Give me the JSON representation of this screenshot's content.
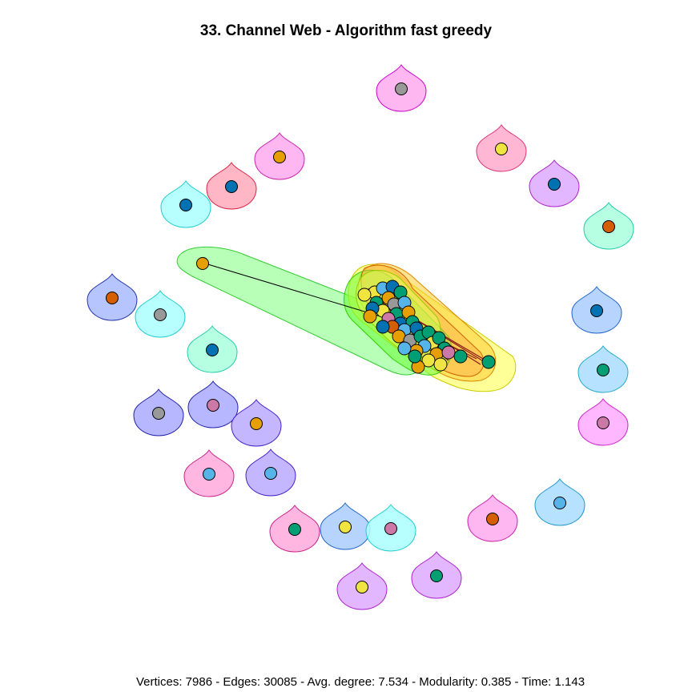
{
  "title": "33. Channel Web - Algorithm fast greedy",
  "caption": "Vertices: 7986 - Edges: 30085 - Avg. degree: 7.534 - Modularity: 0.385 - Time: 1.143",
  "palette": {
    "node_yellow": "#f0e442",
    "node_orange": "#e69f00",
    "node_vermillion": "#d55e00",
    "node_skyblue": "#56b4e9",
    "node_blue": "#0072b2",
    "node_green": "#009e73",
    "node_pink": "#cc79a7",
    "node_gray": "#999999",
    "hull_green": "#66ff66",
    "hull_yellow": "#ffff00",
    "hull_orange": "#ff9900"
  },
  "singleton_communities": [
    {
      "id": 1,
      "node_color": "#999999",
      "hull_fill": "#ffaaee",
      "hull_stroke": "#cc00cc"
    },
    {
      "id": 2,
      "node_color": "#f0e442",
      "hull_fill": "#ffaacc",
      "hull_stroke": "#dd3377"
    },
    {
      "id": 3,
      "node_color": "#0072b2",
      "hull_fill": "#ddaaff",
      "hull_stroke": "#aa22cc"
    },
    {
      "id": 4,
      "node_color": "#d55e00",
      "hull_fill": "#aaffdd",
      "hull_stroke": "#22ccaa"
    },
    {
      "id": 5,
      "node_color": "#e69f00",
      "hull_fill": "#ffaaee",
      "hull_stroke": "#cc22aa"
    },
    {
      "id": 6,
      "node_color": "#0072b2",
      "hull_fill": "#ffaabb",
      "hull_stroke": "#dd2244"
    },
    {
      "id": 7,
      "node_color": "#0072b2",
      "hull_fill": "#aaffff",
      "hull_stroke": "#22cccc"
    },
    {
      "id": 8,
      "node_color": "#d55e00",
      "hull_fill": "#aabbff",
      "hull_stroke": "#2233aa"
    },
    {
      "id": 9,
      "node_color": "#999999",
      "hull_fill": "#aaffff",
      "hull_stroke": "#22cccc"
    },
    {
      "id": 10,
      "node_color": "#0072b2",
      "hull_fill": "#aaffdd",
      "hull_stroke": "#22ccaa"
    },
    {
      "id": 11,
      "node_color": "#0072b2",
      "hull_fill": "#aaccff",
      "hull_stroke": "#2266cc"
    },
    {
      "id": 12,
      "node_color": "#009e73",
      "hull_fill": "#aaddff",
      "hull_stroke": "#22aacc"
    },
    {
      "id": 13,
      "node_color": "#cc79a7",
      "hull_fill": "#ffaaff",
      "hull_stroke": "#cc22cc"
    },
    {
      "id": 14,
      "node_color": "#999999",
      "hull_fill": "#aaaaff",
      "hull_stroke": "#2222aa"
    },
    {
      "id": 15,
      "node_color": "#cc79a7",
      "hull_fill": "#aaaaff",
      "hull_stroke": "#2222aa"
    },
    {
      "id": 16,
      "node_color": "#e69f00",
      "hull_fill": "#bbaaff",
      "hull_stroke": "#4422cc"
    },
    {
      "id": 17,
      "node_color": "#56b4e9",
      "hull_fill": "#bbaaff",
      "hull_stroke": "#4422cc"
    },
    {
      "id": 18,
      "node_color": "#56b4e9",
      "hull_fill": "#ffaadd",
      "hull_stroke": "#cc2288"
    },
    {
      "id": 19,
      "node_color": "#56b4e9",
      "hull_fill": "#aaddff",
      "hull_stroke": "#2299cc"
    },
    {
      "id": 20,
      "node_color": "#d55e00",
      "hull_fill": "#ffaaee",
      "hull_stroke": "#cc22aa"
    },
    {
      "id": 21,
      "node_color": "#009e73",
      "hull_fill": "#ffaadd",
      "hull_stroke": "#cc2288"
    },
    {
      "id": 22,
      "node_color": "#f0e442",
      "hull_fill": "#aaccff",
      "hull_stroke": "#2266cc"
    },
    {
      "id": 23,
      "node_color": "#cc79a7",
      "hull_fill": "#aaffff",
      "hull_stroke": "#22cccc"
    },
    {
      "id": 24,
      "node_color": "#009e73",
      "hull_fill": "#ddaaff",
      "hull_stroke": "#aa22cc"
    },
    {
      "id": 25,
      "node_color": "#f0e442",
      "hull_fill": "#ddaaff",
      "hull_stroke": "#aa22cc"
    }
  ]
}
